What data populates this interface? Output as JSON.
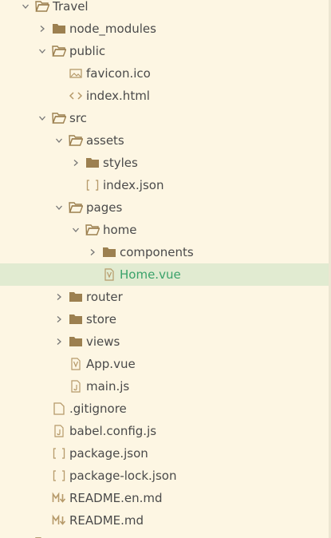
{
  "explorer": {
    "items": [
      {
        "label": "Travel",
        "type": "folder",
        "open": true,
        "depth": 0,
        "icon": "folder-open-icon"
      },
      {
        "label": "node_modules",
        "type": "folder",
        "open": false,
        "depth": 1,
        "icon": "folder-icon"
      },
      {
        "label": "public",
        "type": "folder",
        "open": true,
        "depth": 1,
        "icon": "folder-open-icon"
      },
      {
        "label": "favicon.ico",
        "type": "file",
        "depth": 2,
        "icon": "image-file-icon"
      },
      {
        "label": "index.html",
        "type": "file",
        "depth": 2,
        "icon": "code-file-icon"
      },
      {
        "label": "src",
        "type": "folder",
        "open": true,
        "depth": 1,
        "icon": "folder-open-icon"
      },
      {
        "label": "assets",
        "type": "folder",
        "open": true,
        "depth": 2,
        "icon": "folder-open-icon"
      },
      {
        "label": "styles",
        "type": "folder",
        "open": false,
        "depth": 3,
        "icon": "folder-icon"
      },
      {
        "label": "index.json",
        "type": "file",
        "depth": 3,
        "icon": "json-file-icon"
      },
      {
        "label": "pages",
        "type": "folder",
        "open": true,
        "depth": 2,
        "icon": "folder-open-icon"
      },
      {
        "label": "home",
        "type": "folder",
        "open": true,
        "depth": 3,
        "icon": "folder-open-icon"
      },
      {
        "label": "components",
        "type": "folder",
        "open": false,
        "depth": 4,
        "icon": "folder-icon"
      },
      {
        "label": "Home.vue",
        "type": "file",
        "depth": 4,
        "icon": "vue-file-icon",
        "selected": true
      },
      {
        "label": "router",
        "type": "folder",
        "open": false,
        "depth": 2,
        "icon": "folder-icon"
      },
      {
        "label": "store",
        "type": "folder",
        "open": false,
        "depth": 2,
        "icon": "folder-icon"
      },
      {
        "label": "views",
        "type": "folder",
        "open": false,
        "depth": 2,
        "icon": "folder-icon"
      },
      {
        "label": "App.vue",
        "type": "file",
        "depth": 2,
        "icon": "vue-file-icon"
      },
      {
        "label": "main.js",
        "type": "file",
        "depth": 2,
        "icon": "js-file-icon"
      },
      {
        "label": ".gitignore",
        "type": "file",
        "depth": 1,
        "icon": "generic-file-icon"
      },
      {
        "label": "babel.config.js",
        "type": "file",
        "depth": 1,
        "icon": "js-file-icon"
      },
      {
        "label": "package.json",
        "type": "file",
        "depth": 1,
        "icon": "json-file-icon"
      },
      {
        "label": "package-lock.json",
        "type": "file",
        "depth": 1,
        "icon": "json-file-icon"
      },
      {
        "label": "README.en.md",
        "type": "file",
        "depth": 1,
        "icon": "markdown-file-icon"
      },
      {
        "label": "README.md",
        "type": "file",
        "depth": 1,
        "icon": "markdown-file-icon"
      },
      {
        "label": "",
        "type": "folder",
        "open": true,
        "depth": 0,
        "icon": "folder-open-icon"
      }
    ]
  },
  "colors": {
    "background": "#fdf6e3",
    "selection": "#e1ebd1",
    "selected_text": "#3aa26a",
    "text": "#4a4a4a",
    "folder": "#9c8050",
    "icon": "#b69a6a"
  }
}
